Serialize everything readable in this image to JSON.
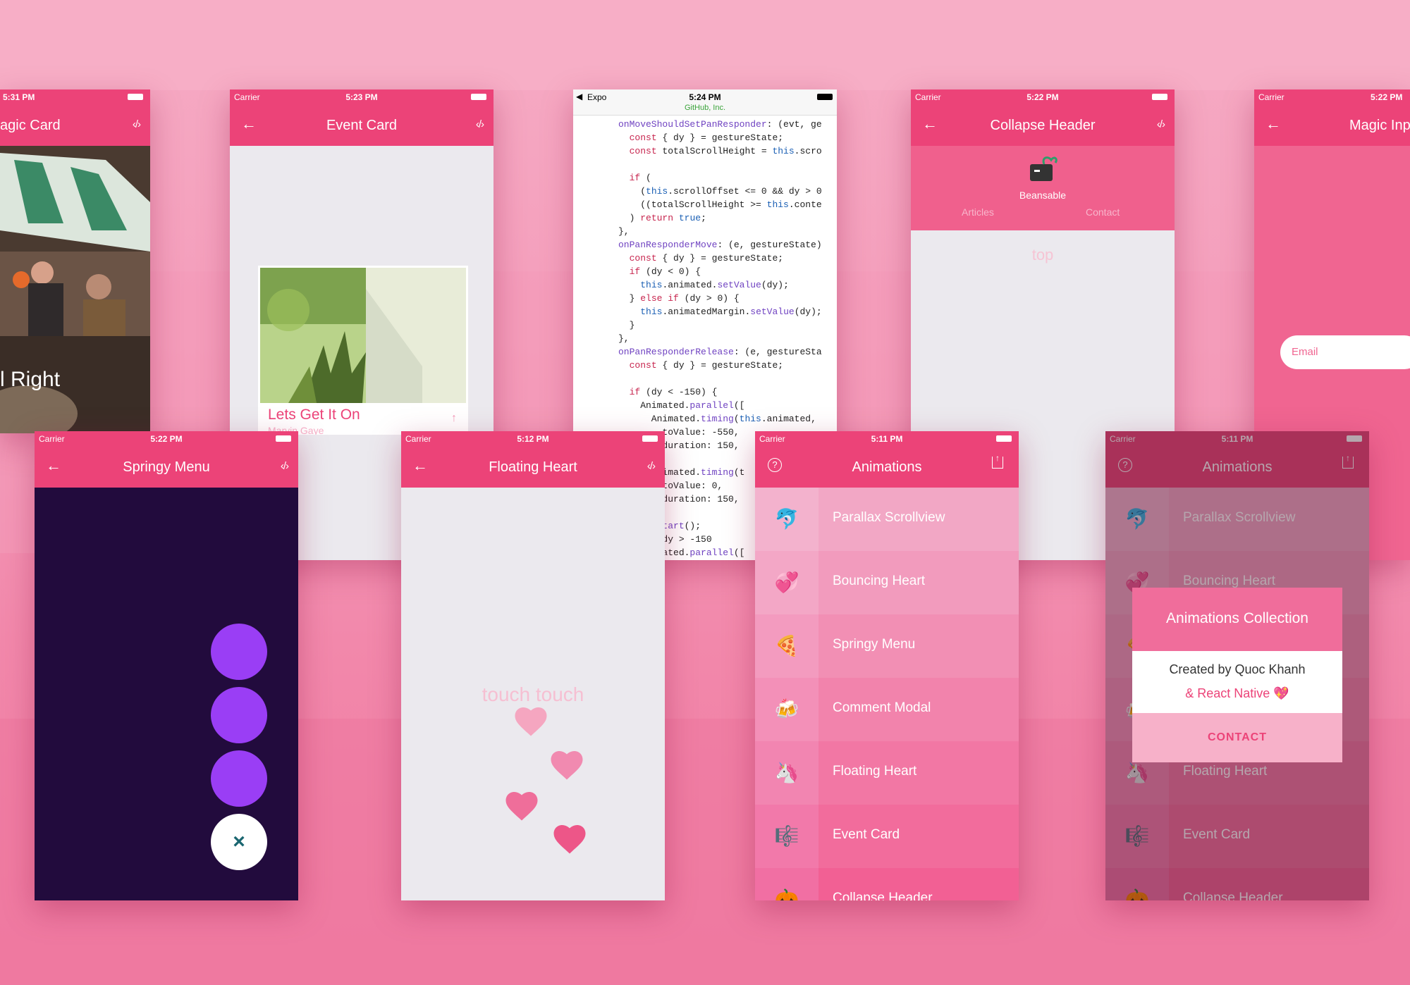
{
  "colors": {
    "brand": "#ec4378",
    "background": "#f49dbb",
    "springy_bg": "#220b3d",
    "bubble": "#9a3ef5"
  },
  "screens": {
    "magic_card": {
      "time": "5:31 PM",
      "title": "agic Card",
      "overlay_text": "l Right"
    },
    "event_card": {
      "carrier": "Carrier",
      "time": "5:23 PM",
      "title": "Event Card",
      "card_title": "Lets Get It On",
      "card_subtitle": "Marvin Gaye"
    },
    "code_view": {
      "carrier": "Expo",
      "time": "5:24 PM",
      "url": "GitHub, Inc.",
      "lines": [
        "onMoveShouldSetPanResponder: (evt, ge",
        "  const { dy } = gestureState;",
        "  const totalScrollHeight = this.scro",
        "",
        "  if (",
        "    (this.scrollOffset <= 0 && dy > 0",
        "    ((totalScrollHeight >= this.conte",
        "  ) return true;",
        "},",
        "onPanResponderMove: (e, gestureState)",
        "  const { dy } = gestureState;",
        "  if (dy < 0) {",
        "    this.animated.setValue(dy);",
        "  } else if (dy > 0) {",
        "    this.animatedMargin.setValue(dy);",
        "  }",
        "},",
        "onPanResponderRelease: (e, gestureSta",
        "  const { dy } = gestureState;",
        "",
        "  if (dy < -150) {",
        "    Animated.parallel([",
        "      Animated.timing(this.animated,",
        "        toValue: -550,",
        "        duration: 150,",
        "      ),",
        "      Animated.timing(t",
        "        toValue: 0,",
        "        duration: 150,",
        "      ),",
        "    ]).start();",
        "  } if (dy > -150",
        "    Animated.parallel(["
      ]
    },
    "collapse_header": {
      "carrier": "Carrier",
      "time": "5:22 PM",
      "title": "Collapse Header",
      "profile_name": "Beansable",
      "tab_articles": "Articles",
      "tab_contact": "Contact",
      "content_label": "top"
    },
    "magic_input": {
      "carrier": "Carrier",
      "time": "5:22 PM",
      "title": "Magic Inp",
      "email_placeholder": "Email"
    },
    "springy_menu": {
      "carrier": "Carrier",
      "time": "5:22 PM",
      "title": "Springy Menu",
      "close_glyph": "×"
    },
    "floating_heart": {
      "carrier": "Carrier",
      "time": "5:12 PM",
      "title": "Floating Heart",
      "touch_text": "touch touch"
    },
    "animations": {
      "carrier": "Carrier",
      "time": "5:11 PM",
      "title": "Animations",
      "items": [
        {
          "emoji": "🐬",
          "label": "Parallax Scrollview"
        },
        {
          "emoji": "💞",
          "label": "Bouncing Heart"
        },
        {
          "emoji": "🍕",
          "label": "Springy Menu"
        },
        {
          "emoji": "🍻",
          "label": "Comment Modal"
        },
        {
          "emoji": "🦄",
          "label": "Floating Heart"
        },
        {
          "emoji": "🎼",
          "label": "Event Card"
        },
        {
          "emoji": "🎃",
          "label": "Collapse Header"
        }
      ]
    },
    "animations_modal": {
      "carrier": "Carrier",
      "time": "5:11 PM",
      "title": "Animations",
      "modal_title": "Animations Collection",
      "created_by": "Created by Quoc Khanh",
      "react_native": "& React Native 💖",
      "contact_label": "CONTACT"
    }
  }
}
